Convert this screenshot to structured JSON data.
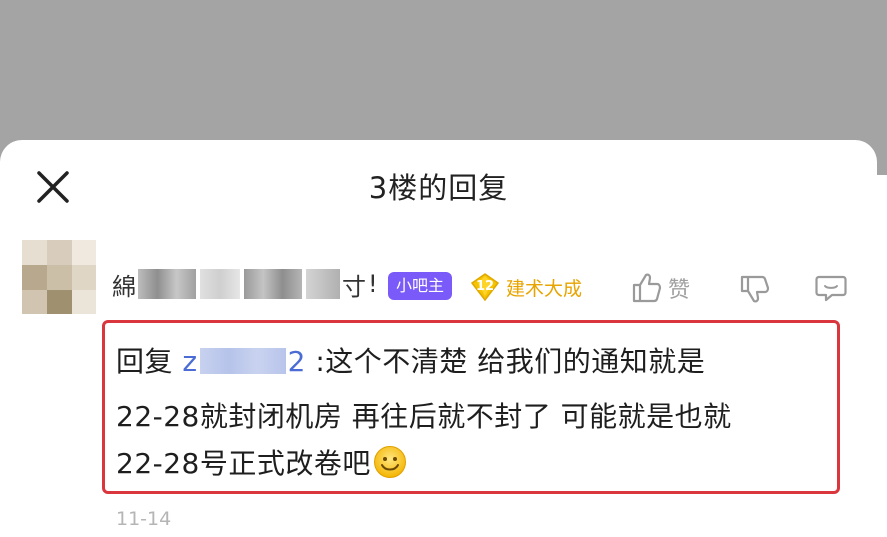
{
  "header": {
    "title": "3楼的回复"
  },
  "comment": {
    "username_first_char": "綿",
    "username_last_char": "寸",
    "username_suffix": "!",
    "owner_badge": "小吧主",
    "level": {
      "number": "12",
      "name": "建术大成"
    },
    "like_label": "赞",
    "reply": {
      "prefix": "回复",
      "mention_start": "z",
      "mention_end": "2",
      "line1_text": ":这个不清楚 给我们的通知就是",
      "line2_text": "22-28就封闭机房 再往后就不封了 可能就是也就",
      "line3_text": "22-28号正式改卷吧"
    },
    "timestamp": "11-14"
  },
  "colors": {
    "highlight_border": "#d9363e",
    "owner_badge_bg": "#7a5af8",
    "level_color": "#e8a400",
    "mention_color": "#4a6cd4",
    "backdrop_dim": "#a4a4a4"
  },
  "icons": {
    "close": "close-icon",
    "like": "thumbs-up-icon",
    "dislike": "thumbs-down-icon",
    "reply": "comment-icon",
    "emoji": "smile-emoji-icon",
    "level_gem": "diamond-icon"
  }
}
